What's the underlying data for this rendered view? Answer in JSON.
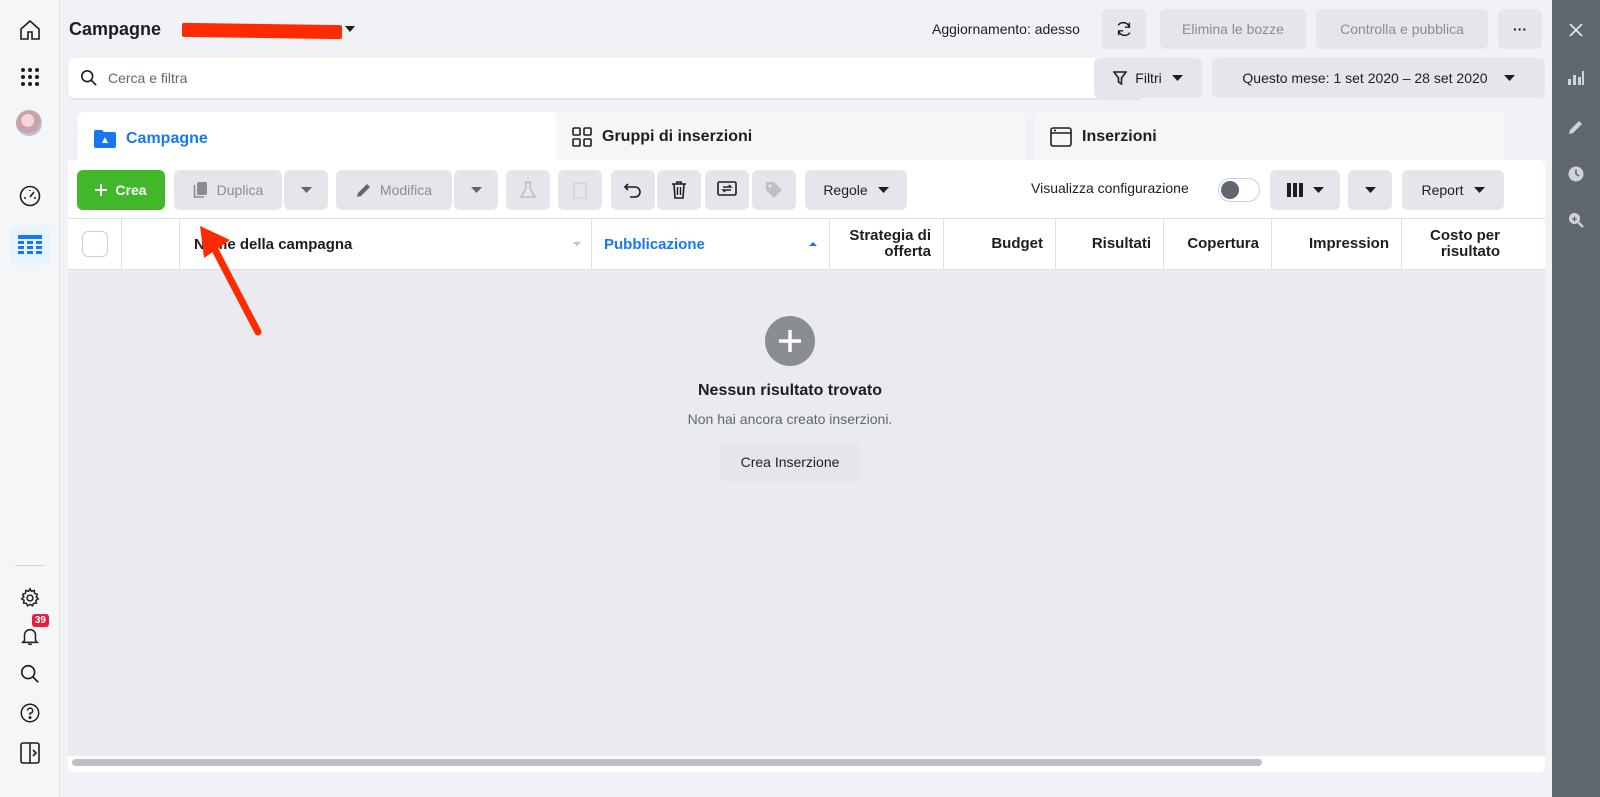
{
  "header": {
    "title": "Campagne",
    "update_status": "Aggiornamento: adesso",
    "discard_drafts_label": "Elimina le bozze",
    "review_publish_label": "Controlla e pubblica",
    "more_label": "···"
  },
  "search": {
    "placeholder": "Cerca e filtra",
    "value": ""
  },
  "filters": {
    "filter_label": "Filtri",
    "date_range_label": "Questo mese: 1 set 2020 – 28 set 2020"
  },
  "tabs": [
    {
      "label": "Campagne",
      "active": true
    },
    {
      "label": "Gruppi di inserzioni",
      "active": false
    },
    {
      "label": "Inserzioni",
      "active": false
    }
  ],
  "toolbar": {
    "create_label": "Crea",
    "duplicate_label": "Duplica",
    "edit_label": "Modifica",
    "rules_label": "Regole",
    "view_setup_label": "Visualizza configurazione",
    "view_setup_on": false,
    "report_label": "Report"
  },
  "table": {
    "columns": [
      "Nome della campagna",
      "Pubblicazione",
      "Strategia di offerta",
      "Budget",
      "Risultati",
      "Copertura",
      "Impression",
      "Costo per risultato"
    ],
    "sorted_column": "Pubblicazione",
    "rows": []
  },
  "empty_state": {
    "title": "Nessun risultato trovato",
    "subtitle": "Non hai ancora creato inserzioni.",
    "button_label": "Crea Inserzione"
  },
  "notifications": {
    "count": "39"
  },
  "colors": {
    "accent_blue": "#1877f2",
    "create_green": "#42b72a",
    "annotation_red": "#ff2a00",
    "right_rail": "#606770"
  },
  "icons": {
    "left_rail": [
      "home-icon",
      "apps-grid-icon",
      "avatar",
      "dashboard-gauge-icon",
      "ads-manager-table-icon",
      "settings-gear-icon",
      "notifications-bell-icon",
      "search-icon",
      "help-icon",
      "panel-toggle-icon"
    ],
    "right_rail": [
      "close-icon",
      "bar-chart-icon",
      "pencil-icon",
      "clock-icon",
      "zoom-search-icon"
    ]
  }
}
